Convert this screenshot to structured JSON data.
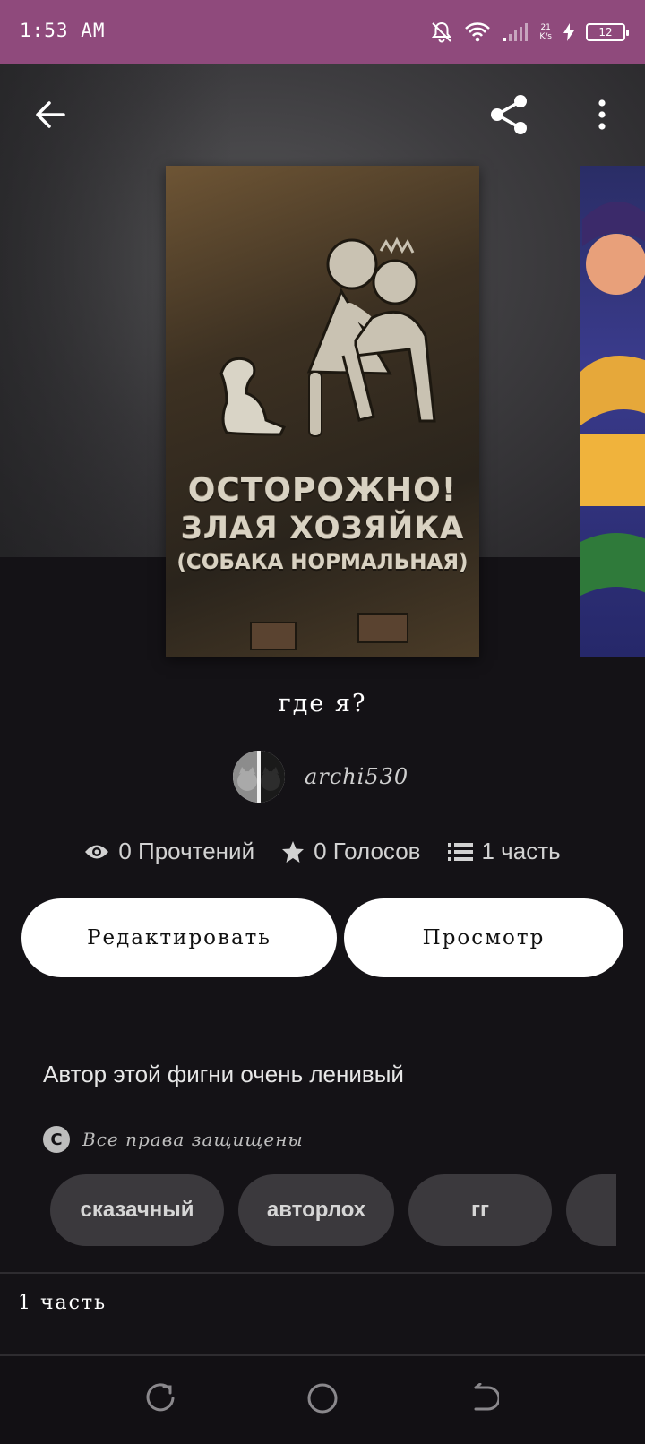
{
  "status_bar": {
    "time": "1:53 AM",
    "net_speed_value": "21",
    "net_speed_unit": "K/s",
    "battery_level": "12",
    "icons": [
      "bell-off-icon",
      "wifi-icon",
      "signal-icon",
      "charging-icon",
      "battery-icon"
    ]
  },
  "toolbar": {
    "icons": [
      "back-arrow-icon",
      "share-icon",
      "more-vertical-icon"
    ]
  },
  "cover": {
    "line1": "ОСТОРОЖНО!",
    "line2": "ЗЛАЯ  ХОЗЯЙКА",
    "line3": "(СОБАКА  НОРМАЛЬНАЯ)"
  },
  "story": {
    "title": "где я?",
    "author": "archi530"
  },
  "stats": {
    "reads": "0 Прочтений",
    "votes": "0 Голосов",
    "parts": "1 часть"
  },
  "actions": {
    "edit_label": "Редактировать",
    "view_label": "Просмотр"
  },
  "description": "Автор этой фигни очень ленивый",
  "copyright": "Все права защищены",
  "tags": [
    "сказачный",
    "авторлох",
    "гг",
    ""
  ],
  "parts_list": {
    "item_1": "1 часть"
  },
  "colors": {
    "status_bar": "#8f4a7c",
    "background": "#141216",
    "tag_bg": "#3b393d",
    "button_bg": "#ffffff"
  },
  "nav_icons": [
    "recent-apps-icon",
    "home-icon",
    "back-nav-icon"
  ]
}
